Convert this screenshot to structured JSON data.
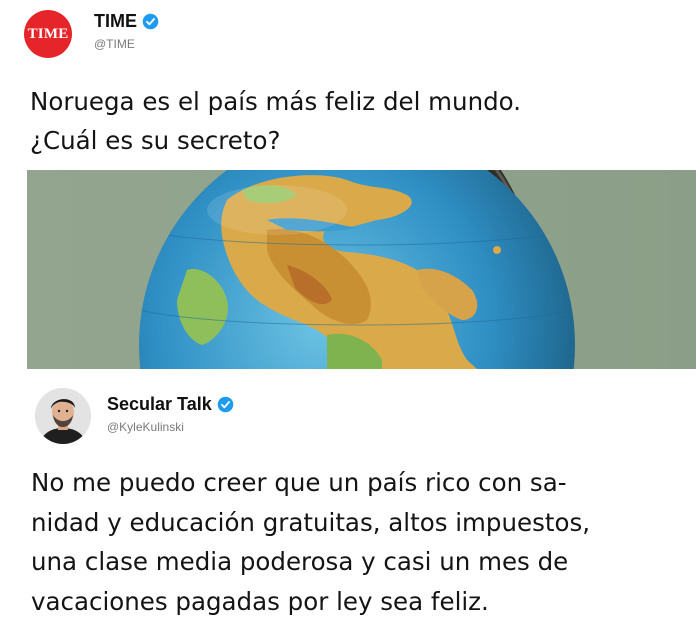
{
  "tweet1": {
    "avatar_logo_text": "TIME",
    "display_name": "TIME",
    "handle": "@TIME",
    "verified": true,
    "text_lines": [
      "Noruega es el país más feliz del mundo.",
      "¿Cuál es su secreto?"
    ],
    "image_icon": "globe-photo"
  },
  "tweet2": {
    "display_name": "Secular Talk",
    "handle": "@KyleKulinski",
    "verified": true,
    "text_lines": [
      "No me puedo creer que un país rico con sa-",
      "nidad y educación gratuitas, altos impuestos,",
      "una clase media poderosa y casi un mes de",
      "vacaciones pagadas por ley sea feliz."
    ]
  },
  "colors": {
    "time_red": "#e5252a",
    "verified_blue": "#1d9bf0",
    "photo_background": "#8ea28b"
  }
}
